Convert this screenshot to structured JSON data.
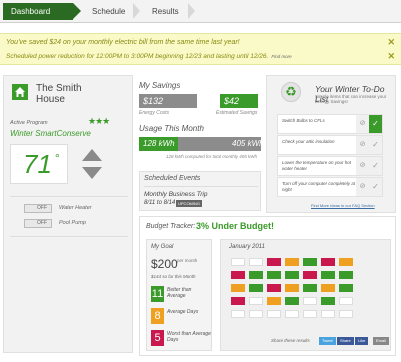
{
  "colors": {
    "accent": "#3a9a2a",
    "nav_active": "#2b6a22",
    "alert_bg": "#fafac8",
    "orange": "#f0a020",
    "red": "#c8184e"
  },
  "nav": {
    "tabs": [
      "Dashboard",
      "Schedule",
      "Results"
    ]
  },
  "alerts": [
    {
      "text": "You've saved $24 on your monthly electric bill from the same time last year!"
    },
    {
      "text": "Scheduled power reduction for 12:00PM to 3:00PM beginning 12/23 and lasting until 12/26.",
      "more": "Find more"
    }
  ],
  "house": {
    "name": "The Smith House",
    "program_label": "Active Program",
    "program_name": "Winter SmartConserve",
    "rating": "★★★"
  },
  "thermostat": {
    "temperature": "71",
    "unit": "°"
  },
  "devices": [
    {
      "state": "OFF",
      "label": "Water Heater"
    },
    {
      "state": "OFF",
      "label": "Pool Pump"
    }
  ],
  "savings": {
    "title": "My Savings",
    "energy_cost": "$132",
    "energy_cost_label": "Energy Costs",
    "estimated": "$42",
    "estimated_label": "Estimated Savings"
  },
  "usage": {
    "title": "Usage This Month",
    "current": "128 kWh",
    "total": "405 kWh",
    "fill_fraction": 0.32,
    "note": "128 kWh computed for total monthly 405 kWh"
  },
  "events": {
    "title": "Scheduled Events",
    "name": "Monthly Business Trip",
    "dates": "8/11 to 8/14",
    "badge": "UPCOMING"
  },
  "todo": {
    "title": "Your Winter To-Do List",
    "subtitle": "Simple items that can increase your Energy Savings!",
    "items": [
      {
        "text": "Switch Bulbs to CFLs",
        "done": true
      },
      {
        "text": "Check your attic insulation",
        "done": false
      },
      {
        "text": "Lower the temperature on your hot water heater",
        "done": false
      },
      {
        "text": "Turn off your computer completely at night",
        "done": false
      }
    ],
    "link": "Find More Ideas in our FAQ Section"
  },
  "budget": {
    "title": "Budget Tracker:",
    "status": "3% Under Budget!",
    "goal_title": "My Goal",
    "goal_amount": "$200",
    "goal_period": "per month",
    "goal_note": "$144 so far this Month",
    "stats": [
      {
        "count": "11",
        "label": "Better than Average",
        "color": "#3a9a2a"
      },
      {
        "count": "8",
        "label": "Average Days",
        "color": "#f0a020"
      },
      {
        "count": "5",
        "label": "Worst than Average Days",
        "color": "#c8184e"
      }
    ],
    "calendar_title": "January 2011",
    "calendar_days": [
      "empty",
      "empty",
      "red",
      "orange",
      "green",
      "red",
      "orange",
      "red",
      "green",
      "green",
      "green",
      "red",
      "green",
      "green",
      "orange",
      "green",
      "red",
      "orange",
      "green",
      "orange",
      "green",
      "red",
      "empty",
      "orange",
      "green",
      "empty",
      "green",
      "empty",
      "empty",
      "empty",
      "empty",
      "empty",
      "empty",
      "empty",
      "empty"
    ],
    "share_label": "Share these results",
    "share_buttons": [
      "Tweet",
      "Share",
      "Like",
      "Email"
    ]
  }
}
